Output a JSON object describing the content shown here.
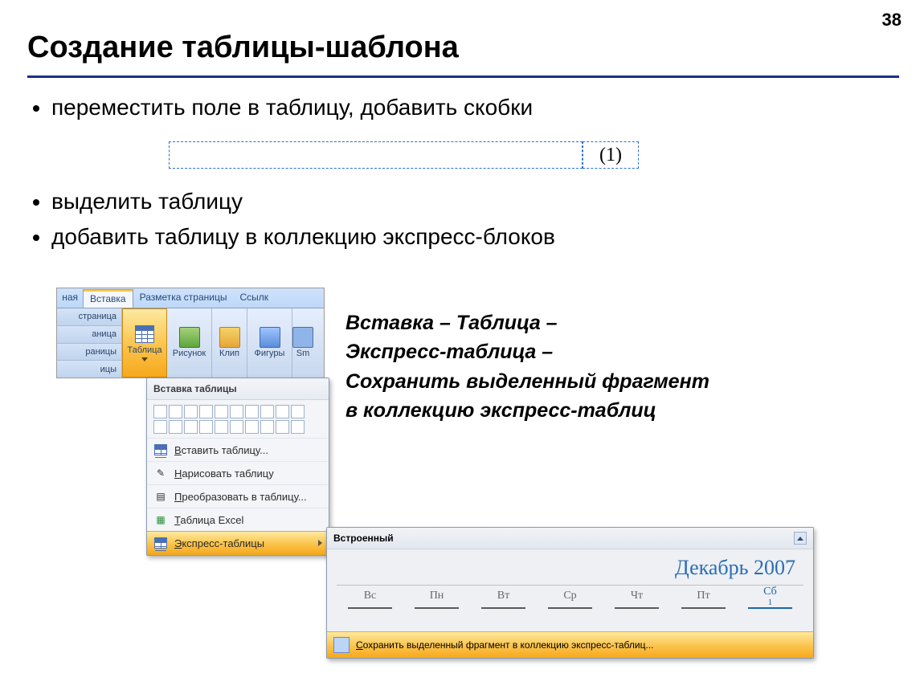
{
  "page_number": "38",
  "title": "Создание таблицы-шаблона",
  "bullets": {
    "b1": "переместить поле в таблицу, добавить скобки",
    "b2": "выделить таблицу",
    "b3": "добавить таблицу в коллекцию экспресс-блоков"
  },
  "field_value": "(1)",
  "ribbon": {
    "tab_cut_left": "ная",
    "tab_active": "Вставка",
    "tab_layout": "Разметка страницы",
    "tab_refs": "Ссылк",
    "left_items": {
      "a": "страница",
      "b": "аница",
      "c": "раницы",
      "d": "ицы"
    },
    "table_label": "Таблица",
    "pic_label": "Рисунок",
    "clip_label": "Клип",
    "shapes_label": "Фигуры",
    "smart_label": "Sm"
  },
  "dropdown": {
    "header": "Вставка таблицы",
    "insert": "Вставить таблицу...",
    "draw": "Нарисовать таблицу",
    "convert": "Преобразовать в таблицу...",
    "excel": "Таблица Excel",
    "express": "Экспресс-таблицы"
  },
  "gallery": {
    "header": "Встроенный",
    "cal_title": "Декабрь 2007",
    "days": {
      "d0": "Вс",
      "d1": "Пн",
      "d2": "Вт",
      "d3": "Ср",
      "d4": "Чт",
      "d5": "Пт",
      "d6": "Сб"
    },
    "sat_num": "1",
    "footer": "Сохранить выделенный фрагмент в коллекцию экспресс-таблиц..."
  },
  "instruction": {
    "l1": "Вставка – Таблица –",
    "l2": "Экспресс-таблица –",
    "l3": "Сохранить выделенный фрагмент",
    "l4": "в коллекцию экспресс-таблиц"
  }
}
